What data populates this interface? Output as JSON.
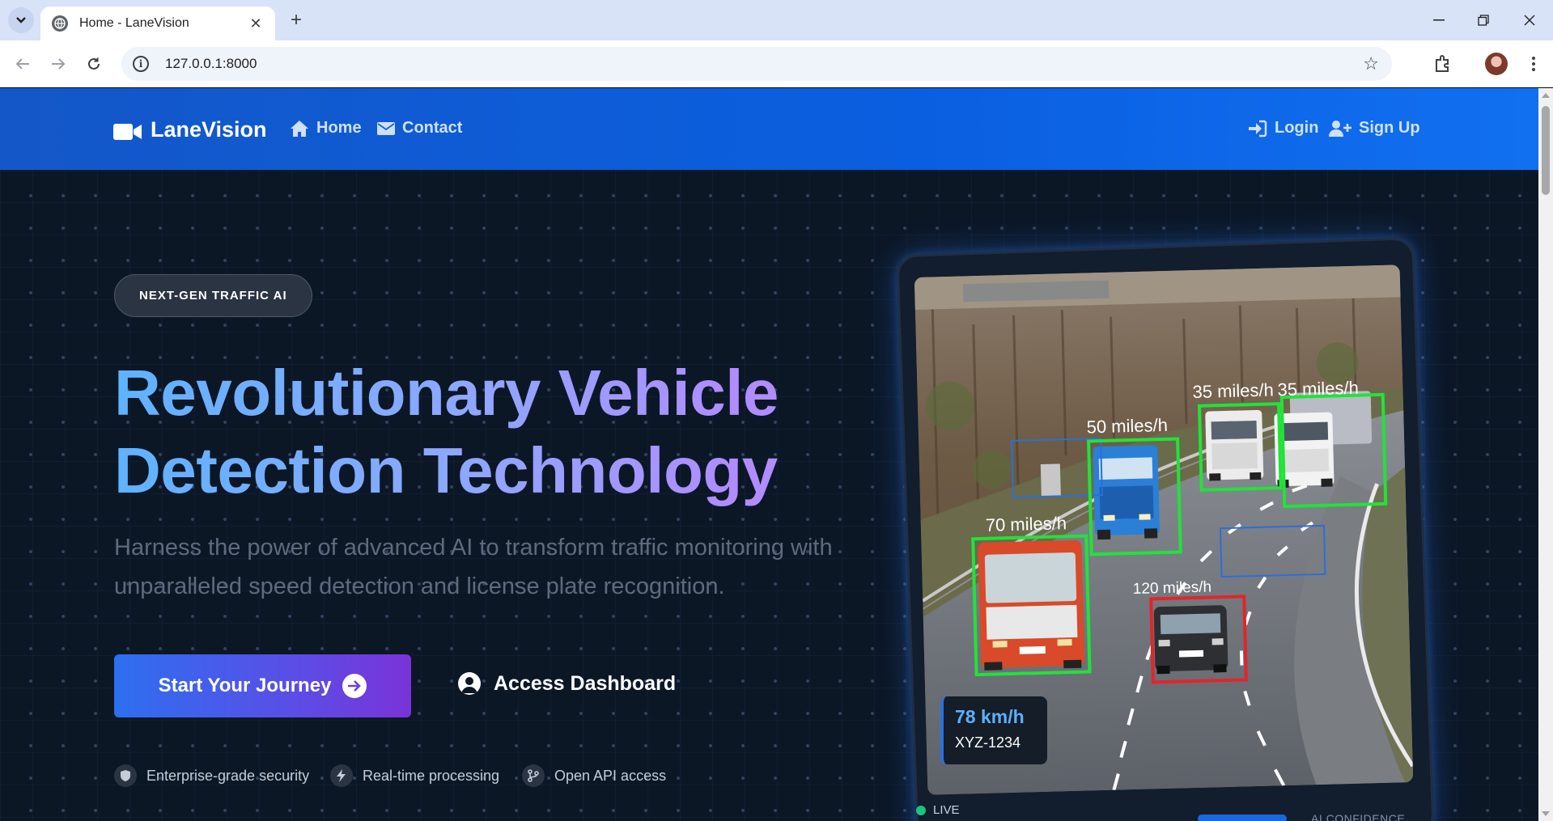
{
  "browser": {
    "tab_title": "Home - LaneVision",
    "url": "127.0.0.1:8000",
    "new_tab_label": "+",
    "close_tab_label": "✕"
  },
  "nav": {
    "brand": "LaneVision",
    "links": [
      {
        "label": "Home",
        "icon": "home-icon"
      },
      {
        "label": "Contact",
        "icon": "envelope-icon"
      }
    ],
    "auth": [
      {
        "label": "Login",
        "icon": "sign-in-icon"
      },
      {
        "label": "Sign Up",
        "icon": "user-plus-icon"
      }
    ]
  },
  "hero": {
    "badge": "NEXT-GEN TRAFFIC AI",
    "headline_line1": "Revolutionary Vehicle",
    "headline_line2": "Detection Technology",
    "subtext": "Harness the power of advanced AI to transform traffic monitoring with unparalleled speed detection and license plate recognition.",
    "primary_cta": "Start Your Journey",
    "secondary_cta": "Access Dashboard",
    "features": [
      {
        "label": "Enterprise-grade security",
        "icon": "shield-icon"
      },
      {
        "label": "Real-time processing",
        "icon": "bolt-icon"
      },
      {
        "label": "Open API access",
        "icon": "code-branch-icon"
      }
    ]
  },
  "mockup": {
    "detections": [
      {
        "label": "70 miles/h",
        "color": "#22e23a"
      },
      {
        "label": "50 miles/h",
        "color": "#22e23a"
      },
      {
        "label": "35 miles/h",
        "color": "#22e23a"
      },
      {
        "label": "35 miles/h",
        "color": "#22e23a"
      },
      {
        "label": "120 miles/h",
        "color": "#e3242b"
      }
    ],
    "speed": "78 km/h",
    "plate": "XYZ-1234",
    "live_label": "LIVE",
    "confidence_label": "AI CONFIDENCE"
  },
  "colors": {
    "nav_blue": "#0a5fe0",
    "hero_bg": "#0c1726",
    "accent_gradient_start": "#2d6ff0",
    "accent_gradient_end": "#7a33d8"
  }
}
